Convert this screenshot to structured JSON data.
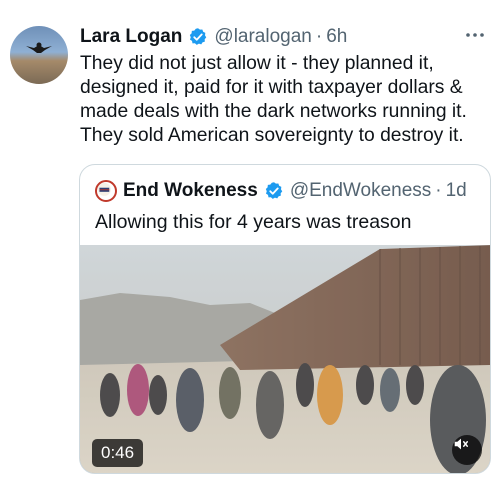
{
  "tweet": {
    "author_name": "Lara Logan",
    "author_handle": "@laralogan",
    "separator": "·",
    "time": "6h",
    "body_lines": [
      "They did not just allow it - they planned it,",
      "designed it, paid for it with taxpayer dollars &",
      "made deals with the dark networks running it.",
      "They sold American sovereignty to destroy it."
    ]
  },
  "quote": {
    "author_name": "End Wokeness",
    "author_handle": "@EndWokeness",
    "separator": "·",
    "time": "1d",
    "text": "Allowing this for 4 years was treason",
    "video": {
      "duration": "0:46",
      "muted": true
    }
  },
  "colors": {
    "verified_blue": "#1d9bf0",
    "secondary_text": "#536471",
    "border": "#cfd9de"
  },
  "icons": [
    "verified-badge-icon",
    "more-options-icon",
    "mute-icon"
  ]
}
